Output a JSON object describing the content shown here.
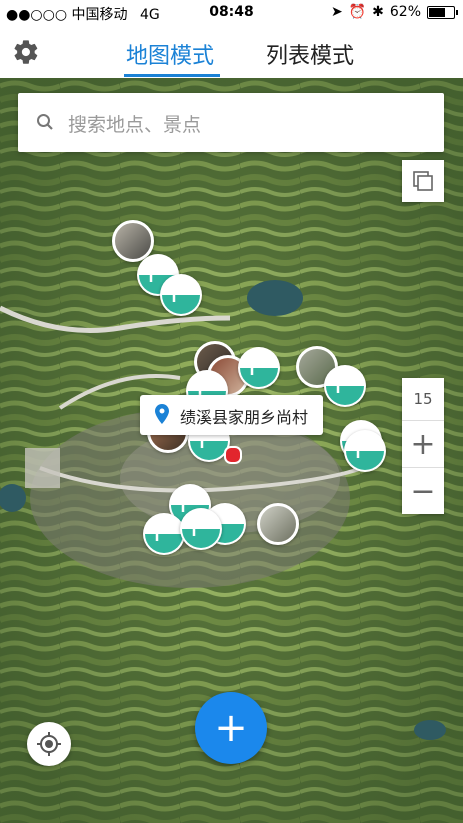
{
  "status_bar": {
    "carrier": "●●○○○ 中国移动",
    "network": "4G",
    "time": "08:48",
    "battery": "62%"
  },
  "header": {
    "tabs": [
      {
        "label": "地图模式",
        "active": true
      },
      {
        "label": "列表模式",
        "active": false
      }
    ],
    "settings_icon": "gear-icon"
  },
  "search": {
    "placeholder": "搜索地点、景点",
    "icon": "search-icon"
  },
  "map": {
    "zoom_level": "15",
    "zoom_in_label": "+",
    "zoom_out_label": "−",
    "location_callout": "绩溪县家朋乡尚村",
    "marker_color": "#2fb59c",
    "pin_color": "#e2262d"
  },
  "fab": {
    "label": "+",
    "color": "#1b88ec"
  },
  "accent_color": "#1b82d6"
}
